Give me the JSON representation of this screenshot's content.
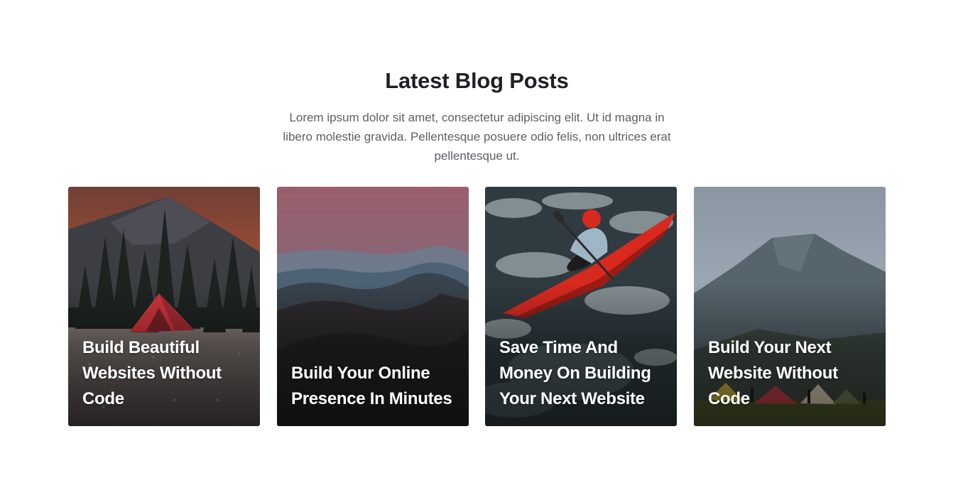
{
  "section": {
    "title": "Latest Blog Posts",
    "subtitle": "Lorem ipsum dolor sit amet, consectetur adipiscing elit. Ut id magna in libero molestie gravida. Pellentesque posuere odio felis, non ultrices erat pellentesque ut."
  },
  "posts": [
    {
      "title": "Build Beautiful Websites Without Code",
      "image": "tent-under-mountain-sunset"
    },
    {
      "title": "Build Your Online Presence In Minutes",
      "image": "misty-mountain-ridges"
    },
    {
      "title": "Save Time And Money On Building Your Next Website",
      "image": "red-kayak-whitewater"
    },
    {
      "title": "Build Your Next Website Without Code",
      "image": "volcano-campsite-tents"
    }
  ],
  "colors": {
    "heading": "#1f2024",
    "body_text": "#5e5e66",
    "card_title": "#ffffff"
  }
}
